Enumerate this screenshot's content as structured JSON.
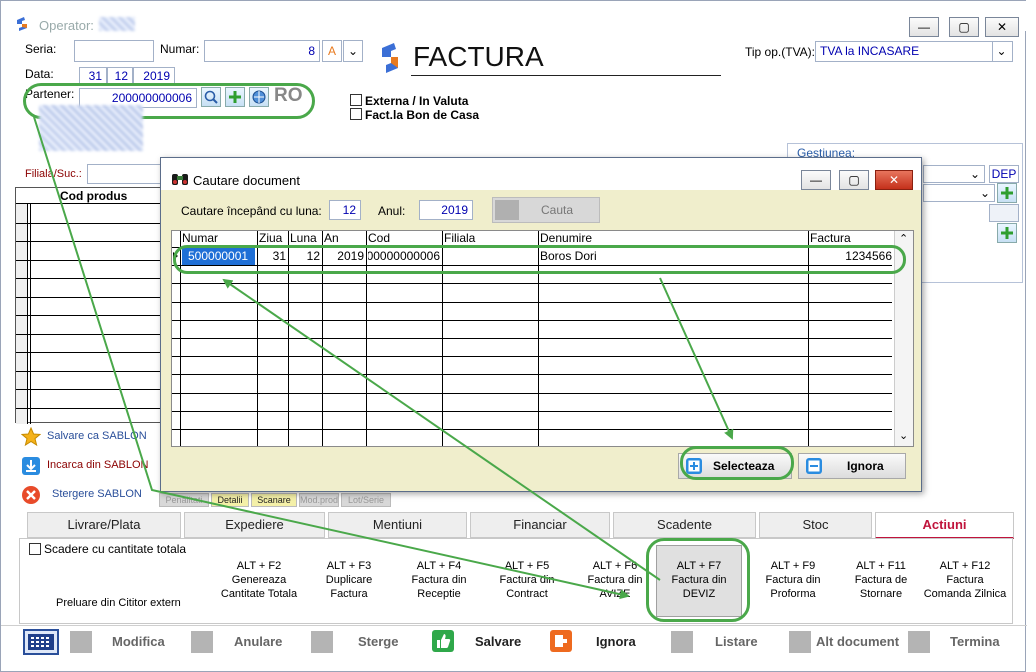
{
  "window": {
    "title": "Operator:",
    "brand_color": "#3b6fd6",
    "accent_color": "#e87a1f",
    "minimize": "—",
    "maximize": "▢",
    "close": "✕"
  },
  "header": {
    "seria_label": "Seria:",
    "seria_value": "",
    "numar_label": "Numar:",
    "numar_value": "8",
    "numar_suffix": "A",
    "data_label": "Data:",
    "day": "31",
    "month": "12",
    "year": "2019",
    "partener_label": "Partener:",
    "partener_value": "200000000006",
    "country": "RO",
    "doc_title": "FACTURA",
    "tip_op_label": "Tip op.(TVA):",
    "tip_op_value": "TVA la INCASARE",
    "externa_label": "Externa / In Valuta",
    "bon_label": "Fact.la Bon de Casa",
    "filiala_label": "Filiala/Suc.:",
    "gestiunea_label": "Gestiunea:",
    "dep_label": "DEP",
    "cod_produs_header": "Cod produs"
  },
  "sablon": {
    "save": "Salvare ca SABLON",
    "load": "Incarca din SABLON",
    "delete": "Stergere SABLON"
  },
  "subtabs": [
    "Penalitati",
    "Detalii",
    "Scanare",
    "Mod.prod",
    "Lot/Serie"
  ],
  "tabs": [
    "Livrare/Plata",
    "Expediere",
    "Mentiuni",
    "Financiar",
    "Scadente",
    "Stoc",
    "Actiuni"
  ],
  "actions": {
    "scadere_label": "Scadere cu cantitate totala",
    "preluare": "Preluare din Cititor extern",
    "items": [
      {
        "key": "ALT + F2",
        "l1": "Genereaza",
        "l2": "Cantitate Totala"
      },
      {
        "key": "ALT + F3",
        "l1": "Duplicare",
        "l2": "Factura"
      },
      {
        "key": "ALT + F4",
        "l1": "Factura din",
        "l2": "Receptie"
      },
      {
        "key": "ALT + F5",
        "l1": "Factura din",
        "l2": "Contract"
      },
      {
        "key": "ALT + F6",
        "l1": "Factura   din",
        "l2": "AVIZE"
      },
      {
        "key": "ALT + F7",
        "l1": "Factura   din",
        "l2": "DEVIZ"
      },
      {
        "key": "ALT + F9",
        "l1": "Factura din",
        "l2": "Proforma"
      },
      {
        "key": "ALT + F11",
        "l1": "Factura de",
        "l2": "Stornare"
      },
      {
        "key": "ALT + F12",
        "l1": "Factura",
        "l2": "Comanda Zilnica"
      }
    ]
  },
  "bottom_bar": {
    "modifica": "Modifica",
    "anulare": "Anulare",
    "sterge": "Sterge",
    "salvare": "Salvare",
    "ignora": "Ignora",
    "listare": "Listare",
    "alt_document": "Alt document",
    "termina": "Termina"
  },
  "dialog": {
    "title": "Cautare document",
    "search_label": "Cautare începând cu luna:",
    "month": "12",
    "year_label": "Anul:",
    "year": "2019",
    "search_button": "Cauta",
    "columns": [
      "Numar",
      "Ziua",
      "Luna",
      "An",
      "Cod",
      "Filiala",
      "Denumire",
      "Factura"
    ],
    "rows": [
      {
        "numar": "500000001",
        "ziua": "31",
        "luna": "12",
        "an": "2019",
        "cod": "00000000006",
        "filiala": "",
        "denumire": "Boros Dori",
        "factura": "1234566"
      }
    ],
    "select_button": "Selecteaza",
    "ignore_button": "Ignora"
  },
  "annotation_color": "#4aa84a"
}
